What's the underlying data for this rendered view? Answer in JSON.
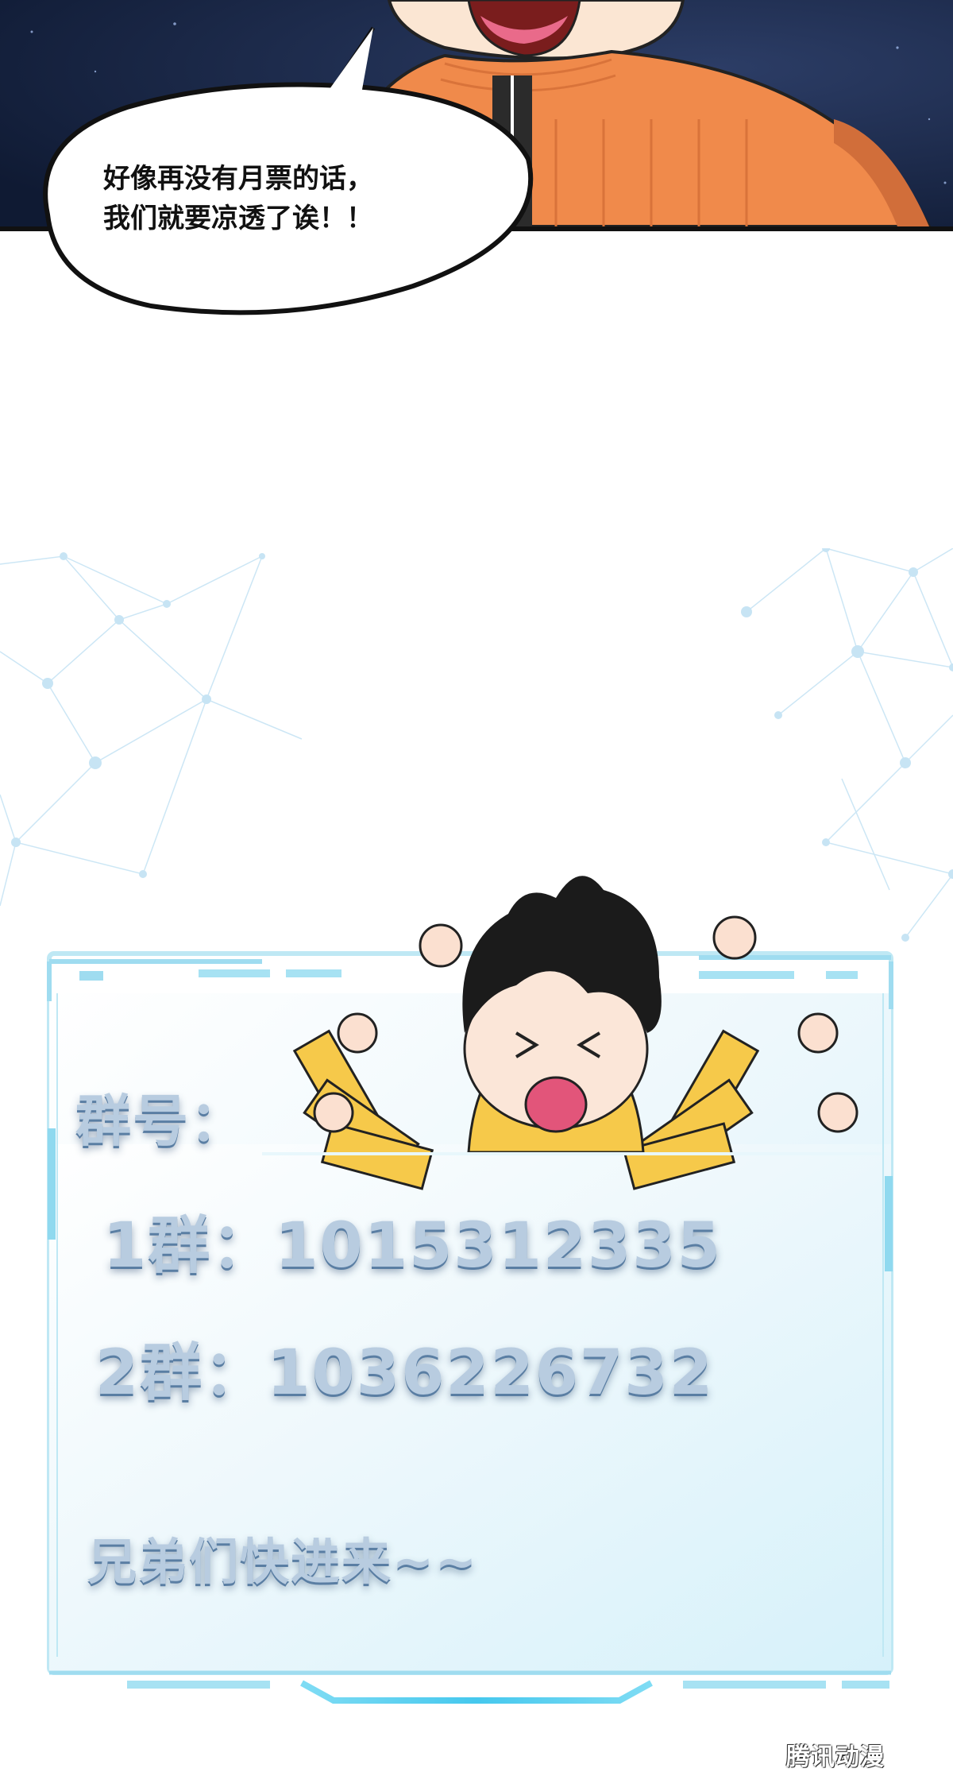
{
  "speech_bubble": {
    "line1": "好像再没有月票的话，",
    "line2": "我们就要凉透了诶！！"
  },
  "group_panel": {
    "heading": "群号：",
    "group1": "1群：1015312335",
    "group2": "2群：1036226732",
    "invite": "兄弟们快进来~~"
  },
  "watermark": "腾讯动漫",
  "colors": {
    "space_bg": "#1b2747",
    "sweater": "#f08a4b",
    "frame_cyan": "#4fd2ef",
    "panel_fill": "#e6f6fb",
    "text_blue": "#b8cce0"
  }
}
